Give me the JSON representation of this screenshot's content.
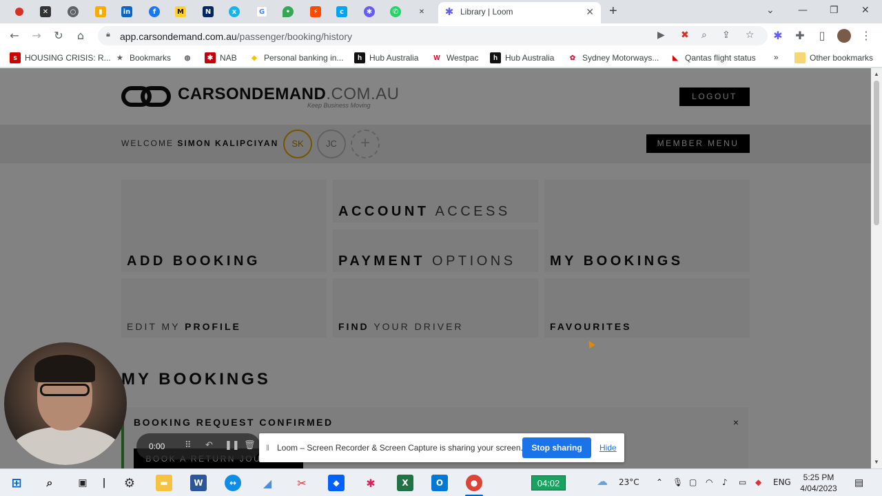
{
  "browser": {
    "tab_title": "Library | Loom",
    "url_host": "app.carsondemand.com.au",
    "url_path": "/passenger/booking/history",
    "bookmarks": [
      {
        "label": "HOUSING CRISIS: R..."
      },
      {
        "label": "Bookmarks"
      },
      {
        "label": "NAB"
      },
      {
        "label": "Personal banking in..."
      },
      {
        "label": "Hub Australia"
      },
      {
        "label": "Westpac"
      },
      {
        "label": "Hub Australia"
      },
      {
        "label": "Sydney Motorways..."
      },
      {
        "label": "Qantas flight status"
      },
      {
        "label": "»"
      },
      {
        "label": "Other bookmarks"
      }
    ]
  },
  "site": {
    "logo_bold": "CARSONDEMAND",
    "logo_light": ".COM.AU",
    "logo_tagline": "Keep Business Moving",
    "logout": "LOGOUT",
    "welcome_prefix": "WELCOME",
    "welcome_name": "SIMON KALIPCIYAN",
    "avatars": [
      "SK",
      "JC",
      "+"
    ],
    "member_menu": "MEMBER MENU",
    "tiles": {
      "add_booking": {
        "bold": "ADD BOOKING",
        "light": ""
      },
      "account_access": {
        "bold": "ACCOUNT",
        "light": "ACCESS"
      },
      "payment_options": {
        "bold": "PAYMENT",
        "light": "OPTIONS"
      },
      "my_bookings": {
        "bold": "MY BOOKINGS",
        "light": ""
      },
      "edit_profile": {
        "light": "EDIT MY",
        "bold": "PROFILE"
      },
      "find_driver": {
        "bold": "FIND",
        "light": "YOUR DRIVER"
      },
      "favourites": {
        "bold": "FAVOURITES",
        "light": ""
      }
    },
    "section_title": "MY BOOKINGS",
    "booking_card": {
      "title": "BOOKING REQUEST CONFIRMED",
      "close": "×",
      "button": "BOOK A RETURN JOURNEY"
    }
  },
  "loom": {
    "timer": "0:00",
    "share_message": "Loom – Screen Recorder & Screen Capture is sharing your screen.",
    "stop_sharing": "Stop sharing",
    "hide": "Hide"
  },
  "taskbar": {
    "rec_timer": "04:02",
    "weather": "23°C",
    "language": "ENG",
    "time": "5:25 PM",
    "date": "4/04/2023"
  },
  "colors": {
    "accent_active_avatar": "#e0a300",
    "booking_border": "#3a9a3a",
    "stop_button": "#1a73e8"
  }
}
